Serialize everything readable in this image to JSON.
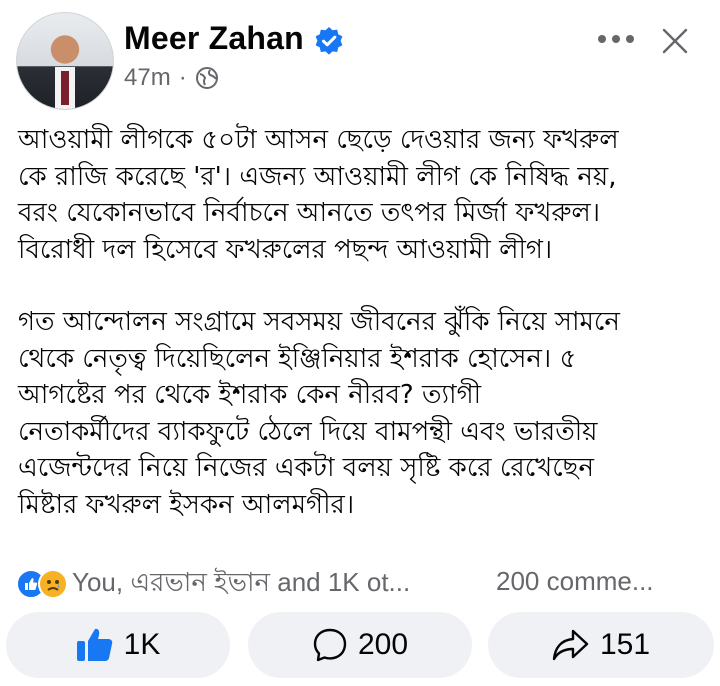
{
  "post": {
    "author": "Meer Zahan",
    "time": "47m",
    "separator": "·",
    "lines_p1": [
      "আওয়ামী লীগকে ৫০টা আসন ছেড়ে দেওয়ার জন্য ফখরুল",
      "কে রাজি করেছে 'র'। এজন্য আওয়ামী লীগ কে নিষিদ্ধ নয়,",
      "বরং যেকোনভাবে নির্বাচনে আনতে তৎপর মির্জা ফখরুল।",
      "বিরোধী দল হিসেবে ফখরুলের পছন্দ আওয়ামী লীগ।"
    ],
    "lines_p2": [
      "গত আন্দোলন সংগ্রামে সবসময় জীবনের ঝুঁকি নিয়ে সামনে",
      "থেকে নেতৃত্ব দিয়েছিলেন ইঞ্জিনিয়ার ইশরাক হোসেন। ৫",
      "আগষ্টের পর থেকে ইশরাক কেন নীরব? ত্যাগী",
      "নেতাকর্মীদের ব্যাকফুটে ঠেলে দিয়ে বামপন্থী এবং ভারতীয়",
      "এজেন্টদের নিয়ে নিজের একটা বলয় সৃষ্টি করে রেখেছেন",
      "মিষ্টার ফখরুল ইসকন আলমগীর।"
    ]
  },
  "reactions": {
    "summary": "You, এরভান ইভান and 1K ot...",
    "comments": "200 comme..."
  },
  "actions": {
    "like_count": "1K",
    "comment_count": "200",
    "share_count": "151"
  },
  "colors": {
    "accent": "#1877f2",
    "muted_text": "#65676b",
    "button_bg": "#eff1f5"
  },
  "icons": [
    "verified-badge-icon",
    "globe-icon",
    "more-options-icon",
    "close-icon",
    "like-reaction-icon",
    "sad-reaction-icon",
    "thumbs-up-icon",
    "comment-bubble-icon",
    "share-arrow-icon"
  ]
}
